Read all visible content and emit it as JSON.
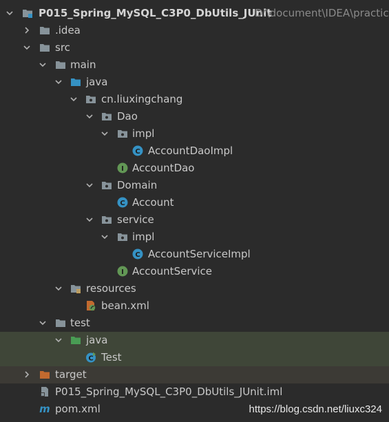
{
  "project": {
    "name": "P015_Spring_MySQL_C3P0_DbUtils_JUnit",
    "path": "D:\\document\\IDEA\\practic"
  },
  "nodes": {
    "idea": ".idea",
    "src": "src",
    "main": "main",
    "java_main": "java",
    "package": "cn.liuxingchang",
    "dao": "Dao",
    "dao_impl": "impl",
    "account_dao_impl": "AccountDaoImpl",
    "account_dao": "AccountDao",
    "domain": "Domain",
    "account": "Account",
    "service": "service",
    "service_impl": "impl",
    "account_service_impl": "AccountServiceImpl",
    "account_service": "AccountService",
    "resources": "resources",
    "bean_xml": "bean.xml",
    "test": "test",
    "java_test": "java",
    "test_class": "Test",
    "target": "target",
    "iml_file": "P015_Spring_MySQL_C3P0_DbUtils_JUnit.iml",
    "pom": "pom.xml"
  },
  "icons": {
    "folder_color": "#87939a",
    "source_folder_color": "#3592c4",
    "test_folder_color": "#499c54",
    "excluded_folder_color": "#c26a2f",
    "class_color": "#3592c4",
    "interface_color": "#629755"
  },
  "watermark": "https://blog.csdn.net/liuxc324"
}
